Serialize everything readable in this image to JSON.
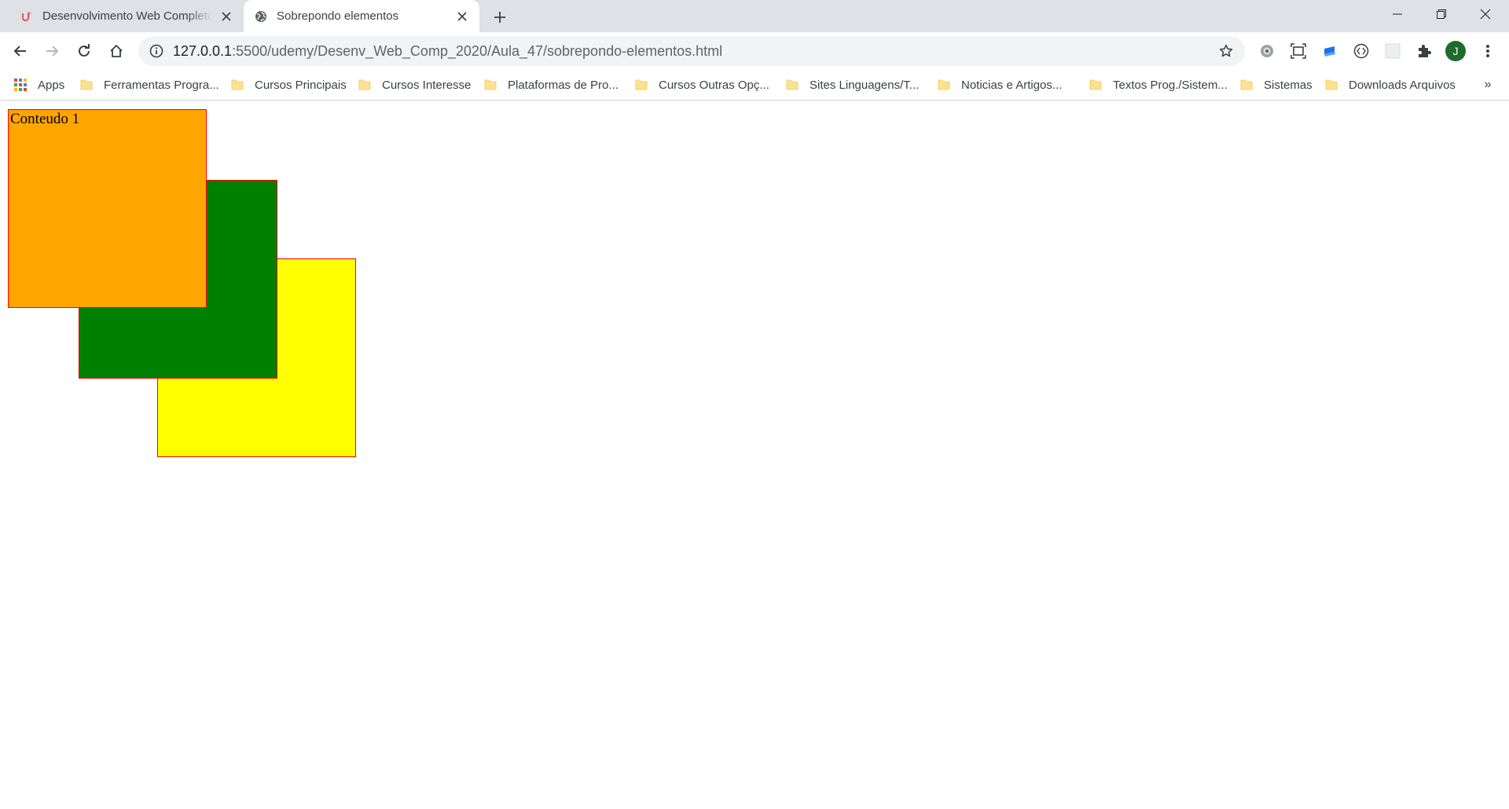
{
  "colors": {
    "tabstrip": "#dee1e6",
    "box_orange": "#ffa500",
    "box_green": "#008000",
    "box_yellow": "#ffff00",
    "box_border": "#ff0000",
    "avatar": "#1e6b2e"
  },
  "tabs": [
    {
      "title": "Desenvolvimento Web Completo",
      "favicon": "udemy-logo-icon",
      "active": false
    },
    {
      "title": "Sobrepondo elementos",
      "favicon": "globe-icon",
      "active": true
    }
  ],
  "toolbar": {
    "url_host": "127.0.0.1",
    "url_rest": ":5500/udemy/Desenv_Web_Comp_2020/Aula_47/sobrepondo-elementos.html",
    "avatar_letter": "J",
    "extensions": [
      "gear-extension-icon",
      "screenshot-extension-icon",
      "book-extension-icon",
      "code-extension-icon",
      "blank-extension-icon",
      "puzzle-icon"
    ]
  },
  "bookmarks": {
    "apps_label": "Apps",
    "items": [
      "Ferramentas Progra...",
      "Cursos Principais",
      "Cursos Interesse",
      "Plataformas de Pro...",
      "Cursos Outras Opç...",
      "Sites Linguagens/T...",
      "Noticias e Artigos...",
      "Textos Prog./Sistem...",
      "Sistemas",
      "Downloads Arquivos"
    ],
    "more": "»"
  },
  "page": {
    "box1_text": "Conteudo 1",
    "box2_text": "",
    "box3_text": ""
  }
}
